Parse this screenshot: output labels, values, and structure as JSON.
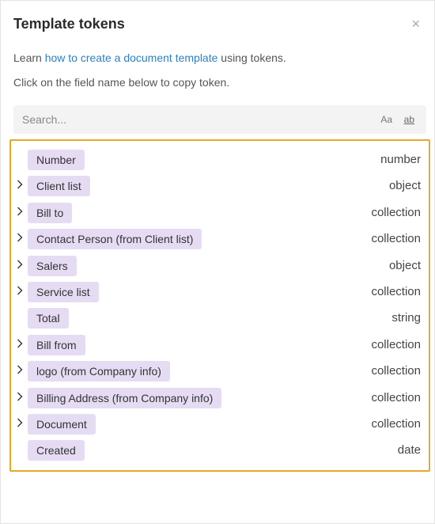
{
  "panel": {
    "title": "Template tokens",
    "close_glyph": "×",
    "intro_prefix": "Learn ",
    "intro_link": "how to create a document template",
    "intro_suffix": " using tokens.",
    "hint": "Click on the field name below to copy token."
  },
  "search": {
    "placeholder": "Search...",
    "match_case_label": "Aa",
    "whole_word_label": "ab"
  },
  "colors": {
    "token_bg": "#e5dcf3",
    "highlight_border": "#e6a92b",
    "link": "#2c7fc3"
  },
  "tokens": [
    {
      "label": "Number",
      "type": "number",
      "expandable": false
    },
    {
      "label": "Client list",
      "type": "object",
      "expandable": true
    },
    {
      "label": "Bill to",
      "type": "collection",
      "expandable": true
    },
    {
      "label": "Contact Person (from Client list)",
      "type": "collection",
      "expandable": true
    },
    {
      "label": "Salers",
      "type": "object",
      "expandable": true
    },
    {
      "label": "Service list",
      "type": "collection",
      "expandable": true
    },
    {
      "label": "Total",
      "type": "string",
      "expandable": false
    },
    {
      "label": "Bill from",
      "type": "collection",
      "expandable": true
    },
    {
      "label": "logo (from Company info)",
      "type": "collection",
      "expandable": true
    },
    {
      "label": "Billing Address (from Company info)",
      "type": "collection",
      "expandable": true
    },
    {
      "label": "Document",
      "type": "collection",
      "expandable": true
    },
    {
      "label": "Created",
      "type": "date",
      "expandable": false
    }
  ]
}
